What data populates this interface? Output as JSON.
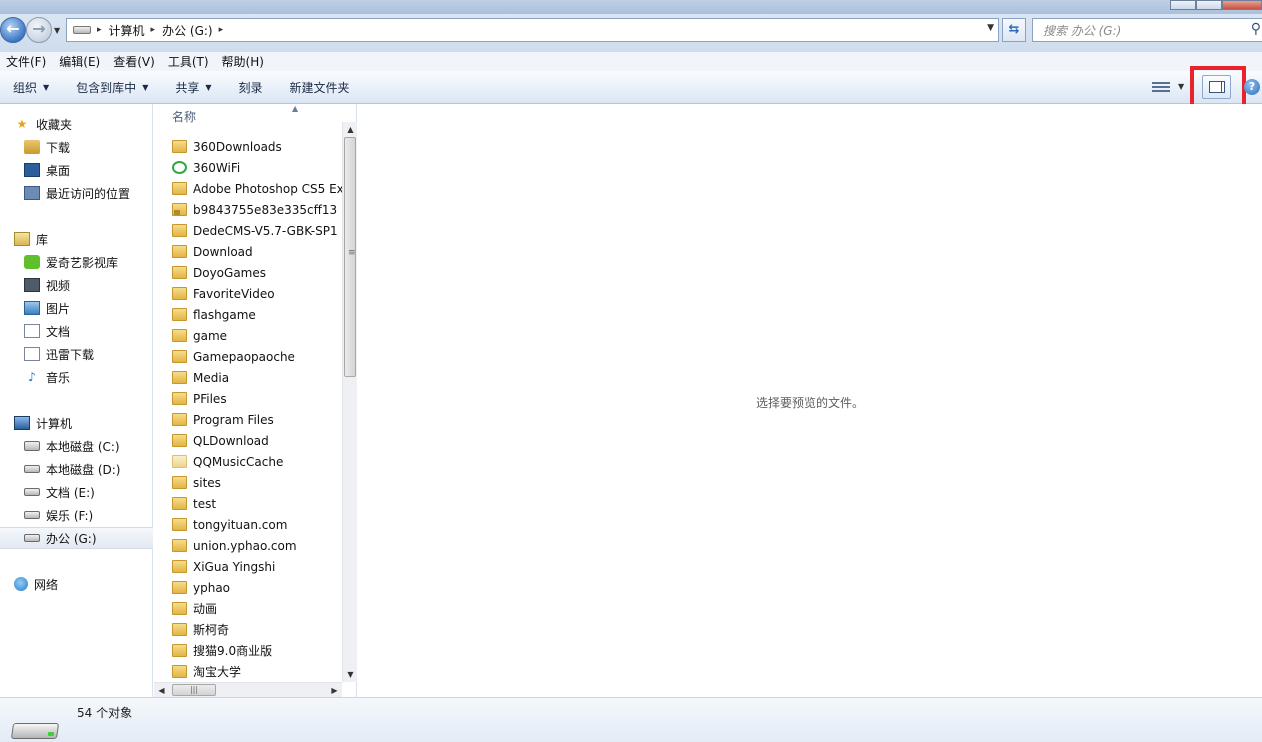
{
  "address": {
    "back_glyph": "←",
    "forward_glyph": "→",
    "separator_glyph": "▸",
    "crumbs": [
      "计算机",
      "办公 (G:)"
    ],
    "search_placeholder": "搜索 办公 (G:)",
    "refresh_glyph": "⇆",
    "search_glyph": "⚲"
  },
  "menu": [
    "文件(F)",
    "编辑(E)",
    "查看(V)",
    "工具(T)",
    "帮助(H)"
  ],
  "toolbar": {
    "organize": "组织",
    "include_in_library": "包含到库中",
    "share": "共享",
    "burn": "刻录",
    "new_folder": "新建文件夹",
    "help_glyph": "?",
    "dropdown_glyph": "▼"
  },
  "nav": {
    "favorites": {
      "label": "收藏夹",
      "items": [
        "下载",
        "桌面",
        "最近访问的位置"
      ]
    },
    "libraries": {
      "label": "库",
      "items": [
        "爱奇艺影视库",
        "视频",
        "图片",
        "文档",
        "迅雷下载",
        "音乐"
      ]
    },
    "computer": {
      "label": "计算机",
      "items": [
        "本地磁盘 (C:)",
        "本地磁盘 (D:)",
        "文档 (E:)",
        "娱乐 (F:)",
        "办公 (G:)"
      ],
      "selected": "办公 (G:)"
    },
    "network": {
      "label": "网络"
    }
  },
  "files": {
    "column_header": "名称",
    "items": [
      "360Downloads",
      "360WiFi",
      "Adobe Photoshop CS5 Ex",
      "b9843755e83e335cff13",
      "DedeCMS-V5.7-GBK-SP1",
      "Download",
      "DoyoGames",
      "FavoriteVideo",
      "flashgame",
      "game",
      "Gamepaopaoche",
      "Media",
      "PFiles",
      "Program Files",
      "QLDownload",
      "QQMusicCache",
      "sites",
      "test",
      "tongyituan.com",
      "union.yphao.com",
      "XiGua Yingshi",
      "yphao",
      "动画",
      "斯柯奇",
      "搜猫9.0商业版",
      "淘宝大学"
    ]
  },
  "preview": {
    "message": "选择要预览的文件。"
  },
  "status": {
    "count": "54 个对象"
  },
  "colors": {
    "highlight": "#e8232b",
    "folder": "#e3b445"
  }
}
